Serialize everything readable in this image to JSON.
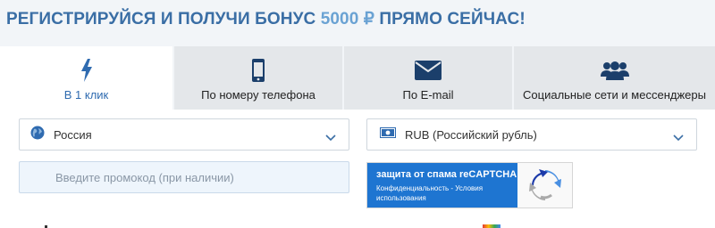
{
  "header": {
    "title_part1": "РЕГИСТРИРУЙСЯ И ПОЛУЧИ БОНУС ",
    "bonus": "5000 ₽",
    "title_part2": " ПРЯМО СЕЙЧАС!"
  },
  "tabs": [
    {
      "label": "В 1 клик",
      "icon": "lightning-icon",
      "active": true
    },
    {
      "label": "По номеру телефона",
      "icon": "phone-icon",
      "active": false
    },
    {
      "label": "По E-mail",
      "icon": "envelope-icon",
      "active": false
    },
    {
      "label": "Социальные сети и мессенджеры",
      "icon": "users-icon",
      "active": false
    }
  ],
  "form": {
    "country": {
      "value": "Россия",
      "icon": "globe-icon"
    },
    "currency": {
      "value": "RUB (Российский рубль)",
      "icon": "banknote-icon"
    },
    "promo": {
      "placeholder": "Введите промокод (при наличии)",
      "value": ""
    },
    "captcha": {
      "title": "защита от спама reCAPTCHA",
      "links": "Конфиденциальность - Условия использования",
      "icon": "recaptcha-icon"
    }
  },
  "colors": {
    "accent": "#2f6bb0",
    "headline": "#3a6ea5",
    "bonus": "#6aa2d3",
    "captcha_blue": "#1e75d1"
  }
}
